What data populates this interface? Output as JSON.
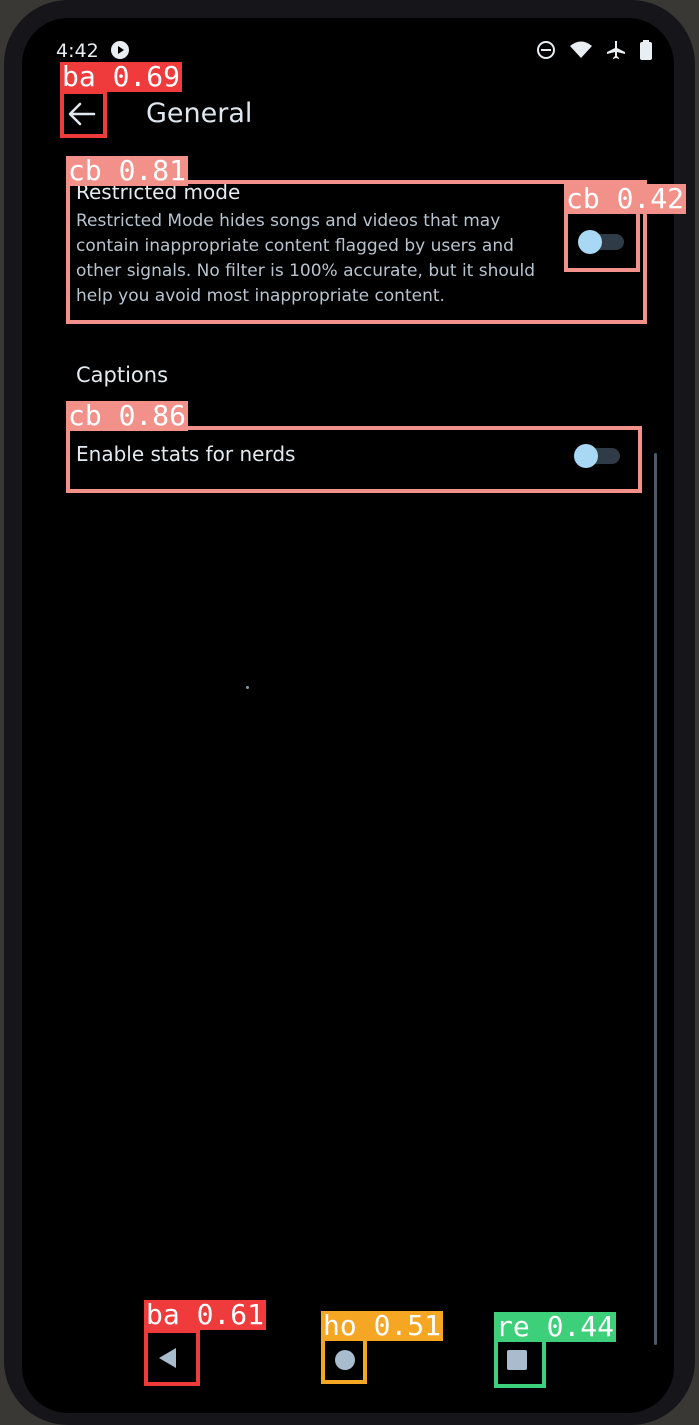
{
  "status_bar": {
    "time": "4:42",
    "icons": [
      "media-app-icon",
      "do-not-disturb-icon",
      "wifi-icon",
      "airplane-mode-icon",
      "battery-icon"
    ]
  },
  "header": {
    "back_icon": "arrow-left-icon",
    "title": "General"
  },
  "settings": {
    "restricted_mode": {
      "title": "Restricted mode",
      "description": "Restricted Mode hides songs and videos that may contain inappropriate content flagged by users and other signals. No filter is 100% accurate, but it should help you avoid most inappropriate content.",
      "enabled": false
    },
    "captions": {
      "label": "Captions"
    },
    "stats_for_nerds": {
      "title": "Enable stats for nerds",
      "enabled": false
    }
  },
  "nav_bar": {
    "back_icon": "triangle-back-icon",
    "home_icon": "circle-home-icon",
    "recents_icon": "square-recents-icon"
  },
  "detections": {
    "back_top": {
      "label": "ba 0.69",
      "color": "#ef3b3b"
    },
    "restricted_row": {
      "label": "cb 0.81",
      "color": "#f2918a"
    },
    "restricted_toggle": {
      "label": "cb 0.42",
      "color": "#f2918a"
    },
    "stats_row": {
      "label": "cb 0.86",
      "color": "#f2918a"
    },
    "nav_back": {
      "label": "ba 0.61",
      "color": "#ef3b3b"
    },
    "nav_home": {
      "label": "ho 0.51",
      "color": "#f5a623"
    },
    "nav_recents": {
      "label": "re 0.44",
      "color": "#3ecf7a"
    }
  },
  "colors": {
    "background": "#000000",
    "accent_toggle_thumb": "#a8d8f4",
    "text_primary": "#e3eaf0"
  }
}
